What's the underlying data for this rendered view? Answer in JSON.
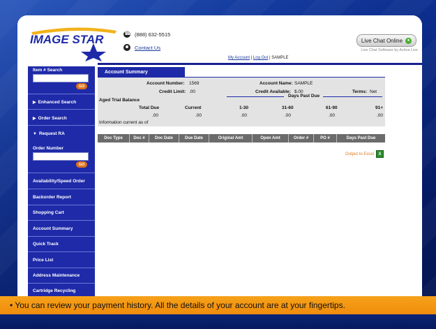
{
  "header": {
    "logo_text": "IMAGE STAR",
    "phone": "(888) 632-5515",
    "contact_link": "Contact Us",
    "live_chat_label": "Live Chat Online",
    "live_chat_sub": "Live Chat Software by Activa Live",
    "nav": {
      "my_account": "My Account",
      "sep1": "|",
      "log_out": "Log Out",
      "sep2": "|",
      "user": "SAMPLE"
    }
  },
  "sidebar": {
    "item_search_label": "Item # Search",
    "go1": "GO",
    "enhanced_search": "Enhanced Search",
    "order_search": "Order Search",
    "request_ra": "Request RA",
    "order_number_label": "Order Number",
    "go2": "GO",
    "items": [
      "Availability/Speed Order",
      "Backorder Report",
      "Shopping Cart",
      "Account Summary",
      "Quick Track",
      "Price List",
      "Address Maintenance",
      "Cartridge Recycling"
    ]
  },
  "summary": {
    "tab": "Account Summary",
    "account_number_label": "Account Number:",
    "account_number": "1569",
    "account_name_label": "Account Name:",
    "account_name": "SAMPLE",
    "credit_limit_label": "Credit Limit:",
    "credit_limit": ".00",
    "credit_available_label": "Credit Available:",
    "credit_available": "$.00",
    "terms_label": "Terms:",
    "terms": "Net",
    "aged_title": "Aged Trial Balance",
    "days_past_due": "Days Past Due",
    "cols": [
      "Total Due",
      "Current",
      "1-30",
      "31-60",
      "61-90",
      "91+"
    ],
    "vals": [
      ".00",
      ".00",
      ".00",
      ".00",
      ".00",
      ".00"
    ],
    "info_current": "Information current as of"
  },
  "grid": {
    "columns": [
      "Doc Type",
      "Doc #",
      "Doc Date",
      "Due Date",
      "Original Amt",
      "Open Amt",
      "Order #",
      "PO #",
      "Days Past Due"
    ]
  },
  "excel": {
    "label": "Output to Excel",
    "icon": "excel-icon"
  },
  "caption": "• You can review your payment history.  All the details of your account are at your fingertips."
}
